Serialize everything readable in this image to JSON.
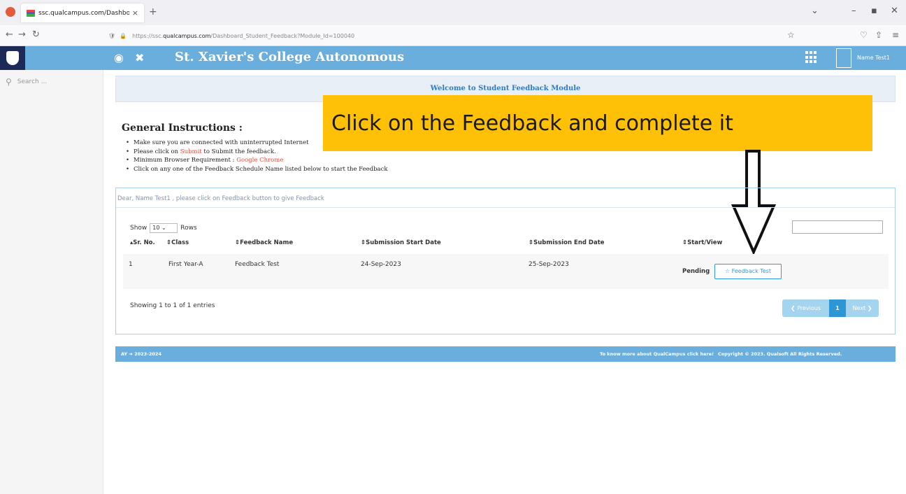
{
  "browser": {
    "tab_title": "ssc.qualcampus.com/Dashbo...",
    "tab_close": "×",
    "new_tab": "+",
    "url_prefix": "https://ssc.",
    "url_domain": "qualcampus.com",
    "url_path": "/Dashboard_Student_Feedback?Module_Id=100040"
  },
  "header": {
    "college_name": "St. Xavier's College Autonomous",
    "user_name": "Name Test1"
  },
  "sidebar": {
    "search_placeholder": "Search ..."
  },
  "welcome_text": "Welcome to Student Feedback Module",
  "instructions": {
    "title": "General Instructions :",
    "items": [
      "Make sure you are connected with uninterrupted Internet",
      "Please click on",
      "Submit",
      "to Submit the feedback.",
      "Minimum Browser Requirement :",
      "Google Chrome",
      "Click on any one of the Feedback Schedule Name listed below to start the Feedback"
    ]
  },
  "callout_text": "Click on the Feedback and complete it",
  "panel": {
    "dear_text": "Dear, Name Test1 , please click on Feedback button to give Feedback",
    "show_label": "Show",
    "show_value": "10",
    "rows_label": "Rows",
    "columns": [
      "Sr. No.",
      "Class",
      "Feedback Name",
      "Submission Start Date",
      "Submission End Date",
      "Start/View"
    ],
    "rows": [
      {
        "sr_no": "1",
        "class": "First Year-A",
        "feedback_name": "Feedback Test",
        "start_date": "24-Sep-2023",
        "end_date": "25-Sep-2023",
        "status": "Pending",
        "button_label": "☆ Feedback Test"
      }
    ],
    "showing_text": "Showing 1 to 1 of 1 entries",
    "pager": {
      "previous": "❮ Previous",
      "current": "1",
      "next": "Next ❯"
    }
  },
  "footer": {
    "left": "AY ➜ 2023-2024",
    "middle": "To know more about QualCampus click here!",
    "right": "Copyright © 2023. Qualsoft All Rights Reserved."
  },
  "colors": {
    "header_blue": "#6aaedd",
    "logo_navy": "#1d2a57",
    "callout_yellow": "#ffc107",
    "link_blue": "#2e9ad8",
    "accent_red": "#e74c3c"
  }
}
